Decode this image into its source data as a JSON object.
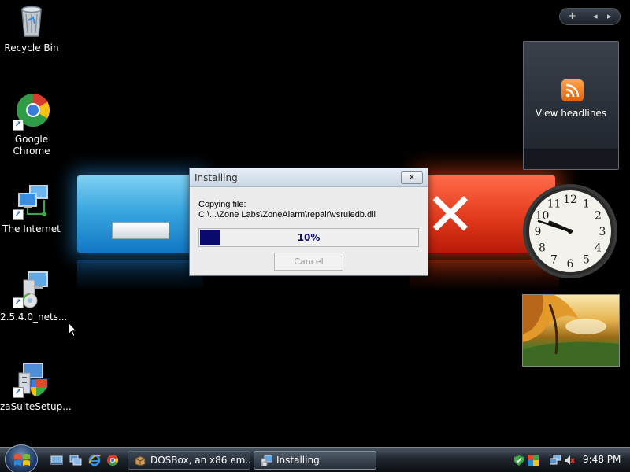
{
  "desktop": {
    "icons": [
      {
        "label": "Recycle Bin",
        "icon": "recycle-bin-icon"
      },
      {
        "label": "Google\nChrome",
        "icon": "chrome-icon"
      },
      {
        "label": "The Internet",
        "icon": "internet-icon"
      },
      {
        "label": "2.5.4.0_nets...",
        "icon": "installer-icon"
      },
      {
        "label": "zaSuiteSetup...",
        "icon": "setup-icon"
      }
    ]
  },
  "dialog": {
    "title": "Installing",
    "message_line1": "Copying file:",
    "message_line2": "C:\\...\\Zone Labs\\ZoneAlarm\\repair\\vsruledb.dll",
    "progress_percent": 10,
    "progress_text": "10%",
    "cancel_label": "Cancel",
    "close_glyph": "✕"
  },
  "sidebar": {
    "controls": {
      "add": "+",
      "prev": "◂",
      "next": "▸"
    },
    "feed_label": "View headlines",
    "clock": {
      "hour": 9,
      "minute": 48
    }
  },
  "taskbar": {
    "tasks": [
      {
        "label": "DOSBox, an x86 em...",
        "icon": "dosbox-icon"
      },
      {
        "label": "Installing",
        "icon": "installer-icon"
      }
    ],
    "time": "9:48 PM"
  },
  "colors": {
    "progress_fill": "#0a0a6e",
    "rss_orange": "#f07c1a",
    "wallpaper_blue": "#3aa7df",
    "wallpaper_red": "#e23a1c"
  }
}
